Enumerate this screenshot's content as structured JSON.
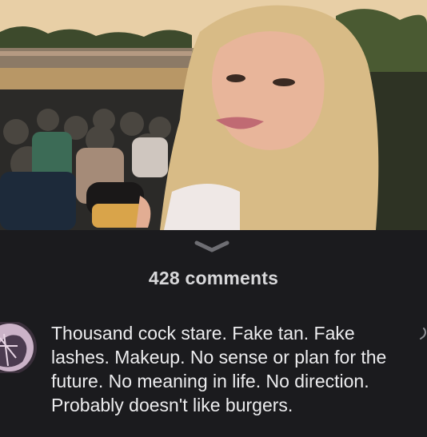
{
  "post": {
    "image_description_icon": "photo-icon"
  },
  "comments_header": {
    "count_label": "428 comments",
    "chevron_icon": "chevron-down-icon"
  },
  "comment": {
    "avatar_icon": "avatar-icon",
    "text": "Thousand cock stare. Fake tan. Fake lashes. Makeup. No sense or plan for the future. No meaning in life. No direction. Probably doesn't like burgers.",
    "more_icon": "more-icon"
  },
  "colors": {
    "background": "#1b1b1e",
    "text": "#ececee",
    "muted": "#8e8e93"
  }
}
